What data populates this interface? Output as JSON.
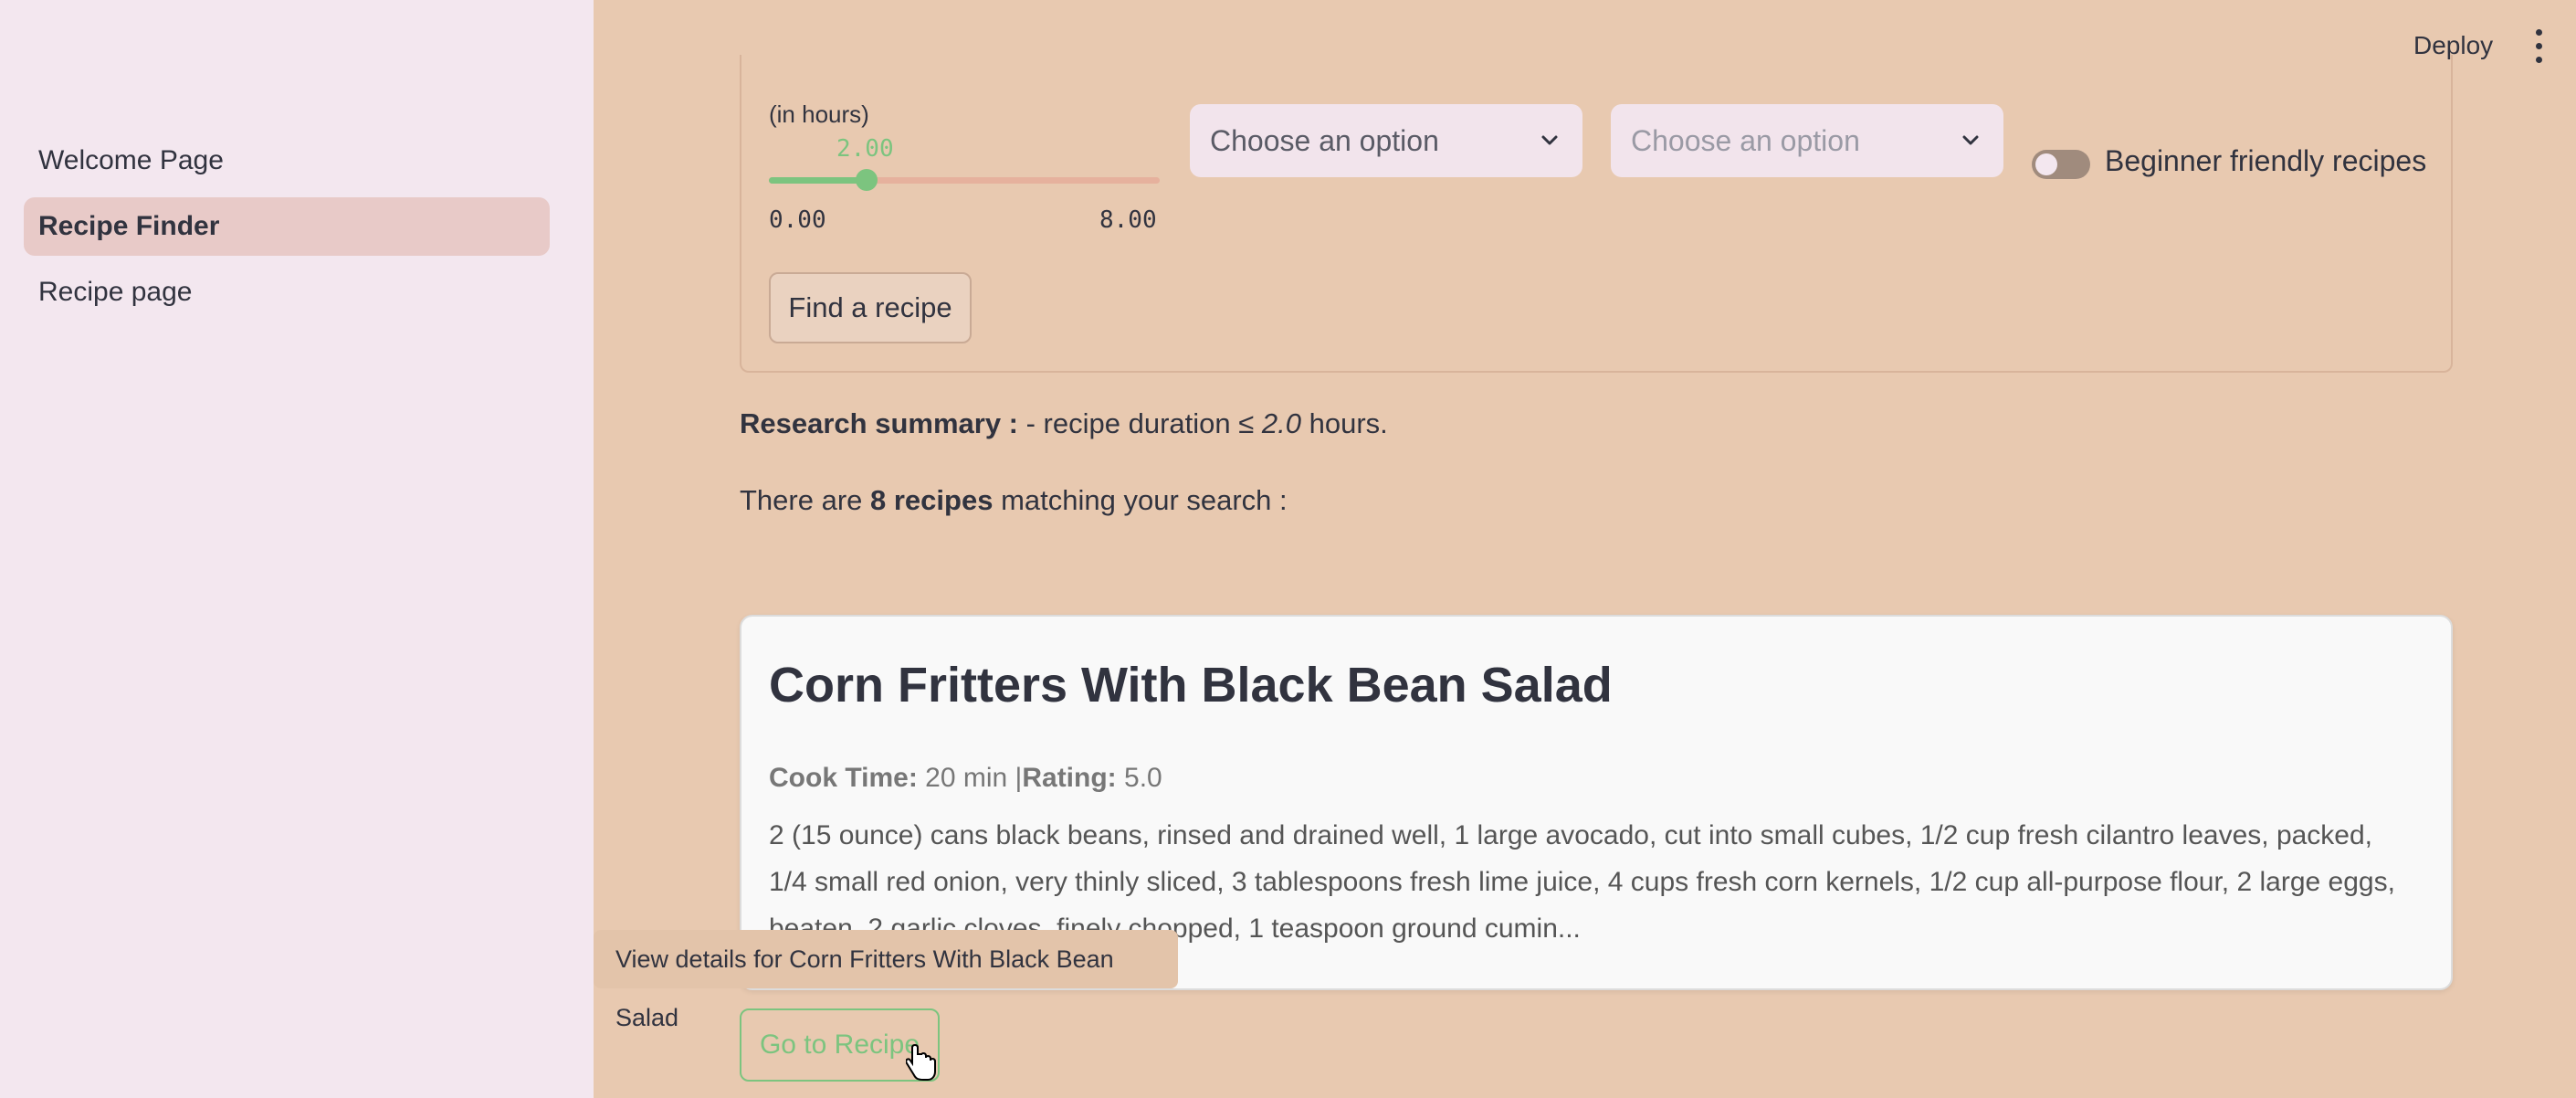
{
  "sidebar": {
    "items": [
      {
        "label": "Welcome Page"
      },
      {
        "label": "Recipe Finder"
      },
      {
        "label": "Recipe page"
      }
    ]
  },
  "topbar": {
    "deploy_label": "Deploy",
    "menu_icon": "more-vertical-icon"
  },
  "form": {
    "duration_label": "(in hours)",
    "slider": {
      "value_text": "2.00",
      "min_text": "0.00",
      "max_text": "8.00",
      "value": 2.0,
      "min": 0.0,
      "max": 8.0
    },
    "select1": {
      "placeholder": "Choose an option"
    },
    "select2": {
      "placeholder": "Choose an option"
    },
    "toggle": {
      "label": "Beginner friendly recipes",
      "on": false
    },
    "find_button": "Find a recipe"
  },
  "summary": {
    "label": "Research summary :",
    "text_before": " - recipe duration ≤ ",
    "value": "2.0",
    "text_after": " hours."
  },
  "count": {
    "before": "There are ",
    "bold": "8 recipes",
    "after": " matching your search :"
  },
  "recipe": {
    "title": "Corn Fritters With Black Bean Salad",
    "cook_time_label": "Cook Time:",
    "cook_time": "20 min",
    "sep": "|",
    "rating_label": "Rating:",
    "rating": "5.0",
    "description": "2 (15 ounce) cans black beans, rinsed and drained well, 1 large avocado, cut into small cubes, 1/2 cup fresh cilantro leaves, packed, 1/4 small red onion, very thinly sliced, 3 tablespoons fresh lime juice, 4 cups fresh corn kernels, 1/2 cup all-purpose flour, 2 large eggs, beaten, 2 garlic cloves, finely chopped, 1 teaspoon ground cumin..."
  },
  "tooltip": "View details for Corn Fritters With Black Bean Salad",
  "goto_button": "Go to Recipe",
  "colors": {
    "main_bg": "#e8c9b0",
    "sidebar_bg": "#f3e7ef",
    "accent_green": "#7cc47f",
    "active_nav": "#e8cac8"
  }
}
